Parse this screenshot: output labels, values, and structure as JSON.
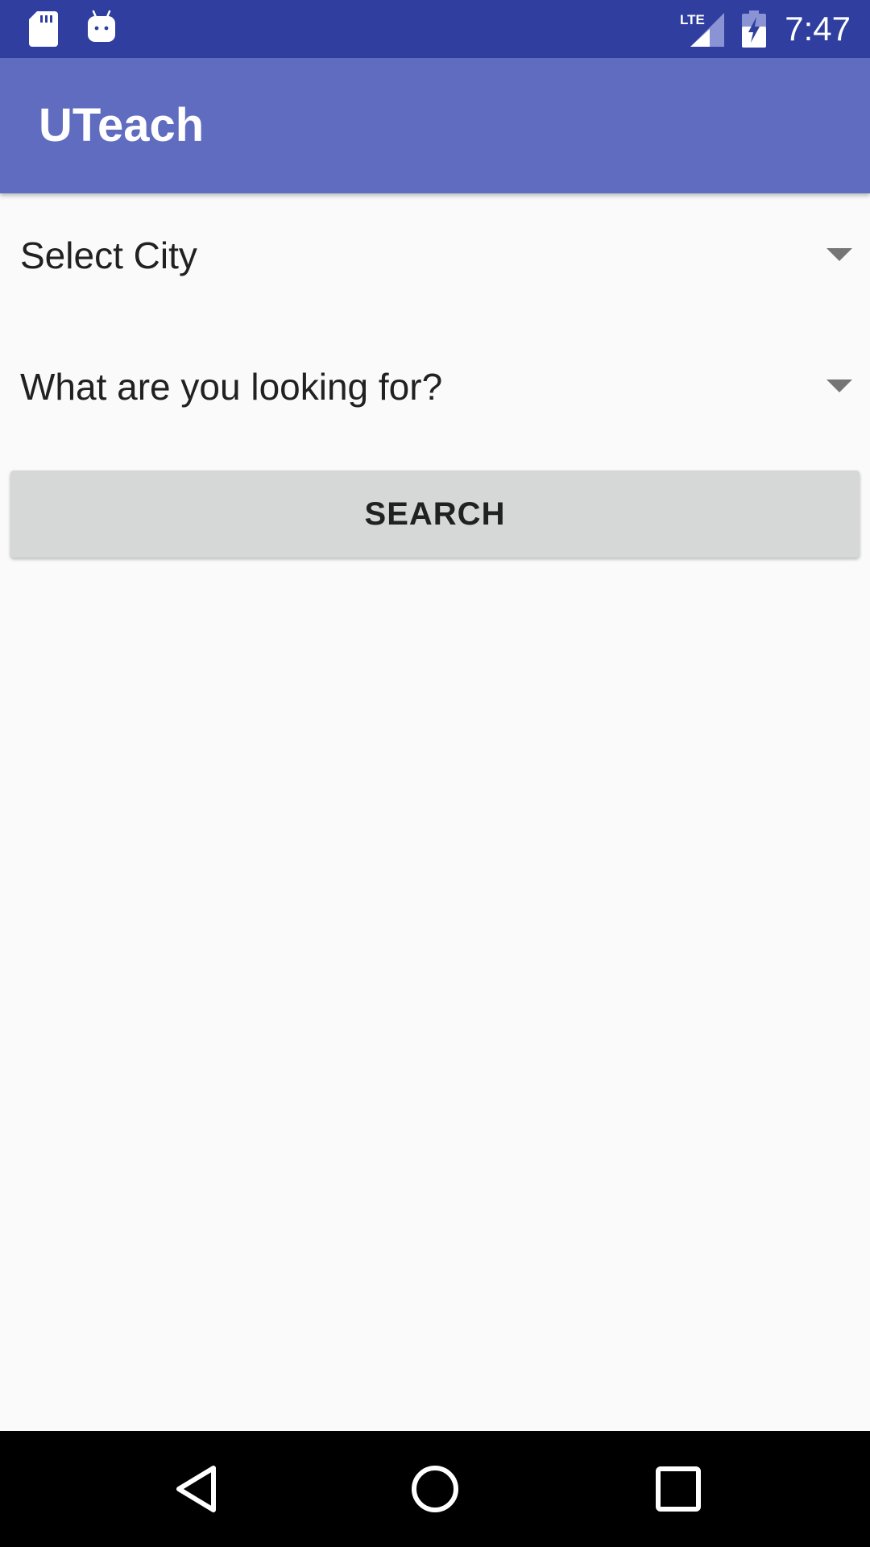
{
  "status_bar": {
    "time": "7:47",
    "network": "LTE",
    "icons": [
      "sd-card-icon",
      "android-debug-icon",
      "lte-signal-icon",
      "battery-charging-icon"
    ],
    "background_color": "#303f9f"
  },
  "app_bar": {
    "title": "UTeach",
    "background_color": "#5f6cc0"
  },
  "form": {
    "city_spinner": {
      "selected": "Select City",
      "icon": "dropdown-arrow-icon"
    },
    "category_spinner": {
      "selected": "What are you looking for?",
      "icon": "dropdown-arrow-icon"
    },
    "search_button": {
      "label": "SEARCH"
    }
  },
  "nav_bar": {
    "buttons": [
      "back-icon",
      "home-icon",
      "recents-icon"
    ]
  }
}
